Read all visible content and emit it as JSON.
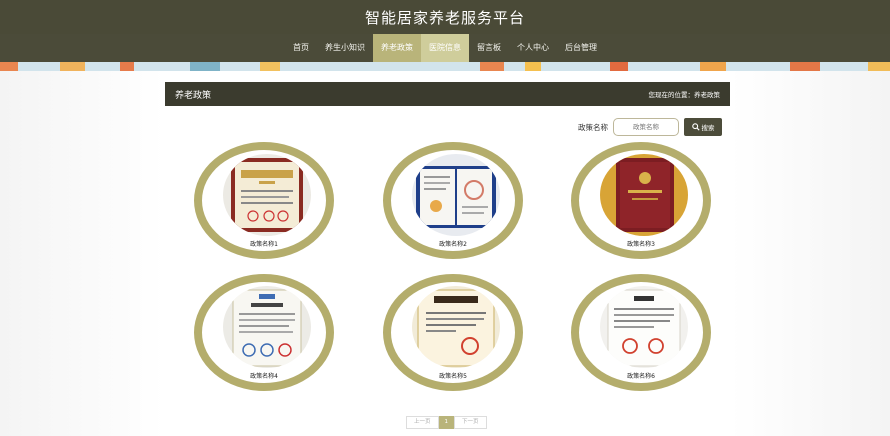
{
  "header": {
    "title": "智能居家养老服务平台"
  },
  "nav": {
    "items": [
      {
        "label": "首页"
      },
      {
        "label": "养生小知识"
      },
      {
        "label": "养老政策"
      },
      {
        "label": "医院信息"
      },
      {
        "label": "留言板"
      },
      {
        "label": "个人中心"
      },
      {
        "label": "后台管理"
      }
    ],
    "active_index": 2
  },
  "section": {
    "title": "养老政策",
    "breadcrumb": "您现在的位置：养老政策"
  },
  "search": {
    "label": "政策名称",
    "placeholder": "政策名称",
    "button_label": "搜索",
    "button_icon": "search-icon"
  },
  "policies": [
    {
      "name": "政策名称1"
    },
    {
      "name": "政策名称2"
    },
    {
      "name": "政策名称3"
    },
    {
      "name": "政策名称4"
    },
    {
      "name": "政策名称5"
    },
    {
      "name": "政策名称6"
    }
  ],
  "pagination": {
    "prev": "上一页",
    "current": "1",
    "next": "下一页"
  },
  "colors": {
    "header_bg": "#4a4a37",
    "accent": "#b9b47a",
    "card_border": "#b4ad6c",
    "section_bg": "#3b3b2e"
  }
}
